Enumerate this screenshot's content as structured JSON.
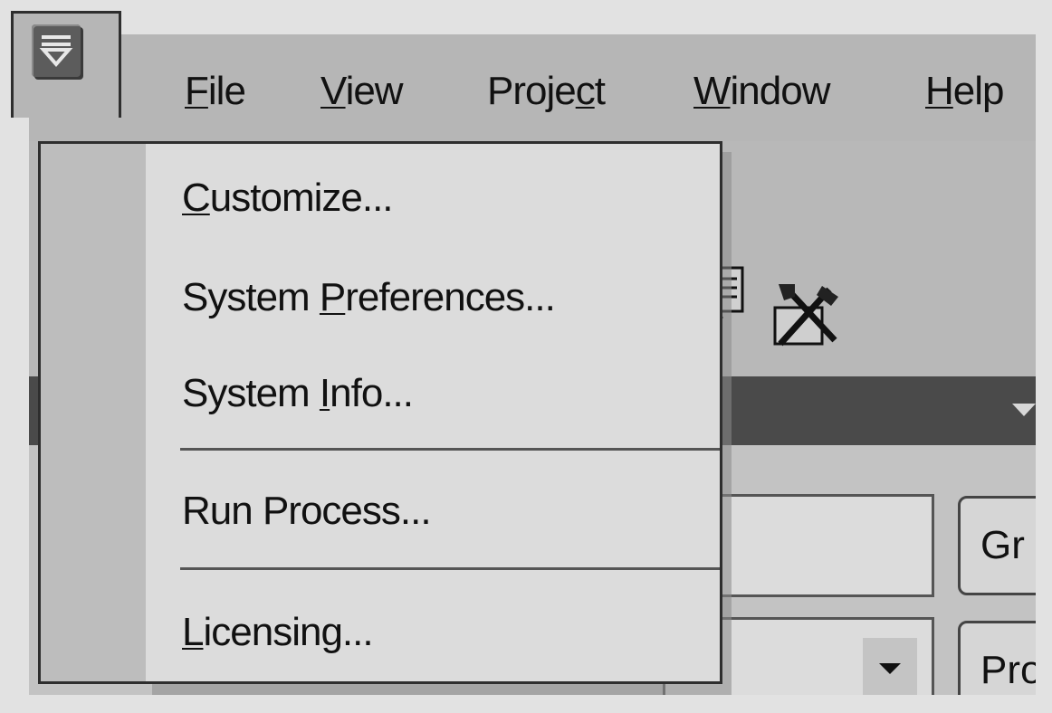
{
  "menubar": {
    "items": [
      {
        "label": "File",
        "mnemonic": "F",
        "rest": "ile"
      },
      {
        "label": "View",
        "mnemonic": "V",
        "rest": "iew"
      },
      {
        "label": "Project",
        "before": "Proje",
        "mnemonic": "c",
        "rest": "t"
      },
      {
        "label": "Window",
        "mnemonic": "W",
        "rest": "indow"
      },
      {
        "label": "Help",
        "mnemonic": "H",
        "rest": "elp"
      }
    ]
  },
  "dropdown": {
    "items": [
      {
        "label": "Customize...",
        "before": "",
        "mnemonic": "C",
        "rest": "ustomize..."
      },
      {
        "label": "System Preferences...",
        "before": "System ",
        "mnemonic": "P",
        "rest": "references..."
      },
      {
        "label": "System Info...",
        "before": "System ",
        "mnemonic": "I",
        "rest": "nfo..."
      },
      {
        "label": "Run Process...",
        "before": "",
        "mnemonic": "",
        "rest": "Run Process..."
      },
      {
        "label": "Licensing...",
        "before": "",
        "mnemonic": "L",
        "rest": "icensing..."
      }
    ]
  },
  "side_buttons": {
    "top_label": "Gr",
    "bottom_label": "Pro"
  },
  "icons": {
    "app_menu": "app-menu-icon",
    "toolbar_doc": "document-icon",
    "toolbar_tools": "tools-icon",
    "band": "chevron-down-icon",
    "combo": "dropdown-arrow-icon"
  }
}
